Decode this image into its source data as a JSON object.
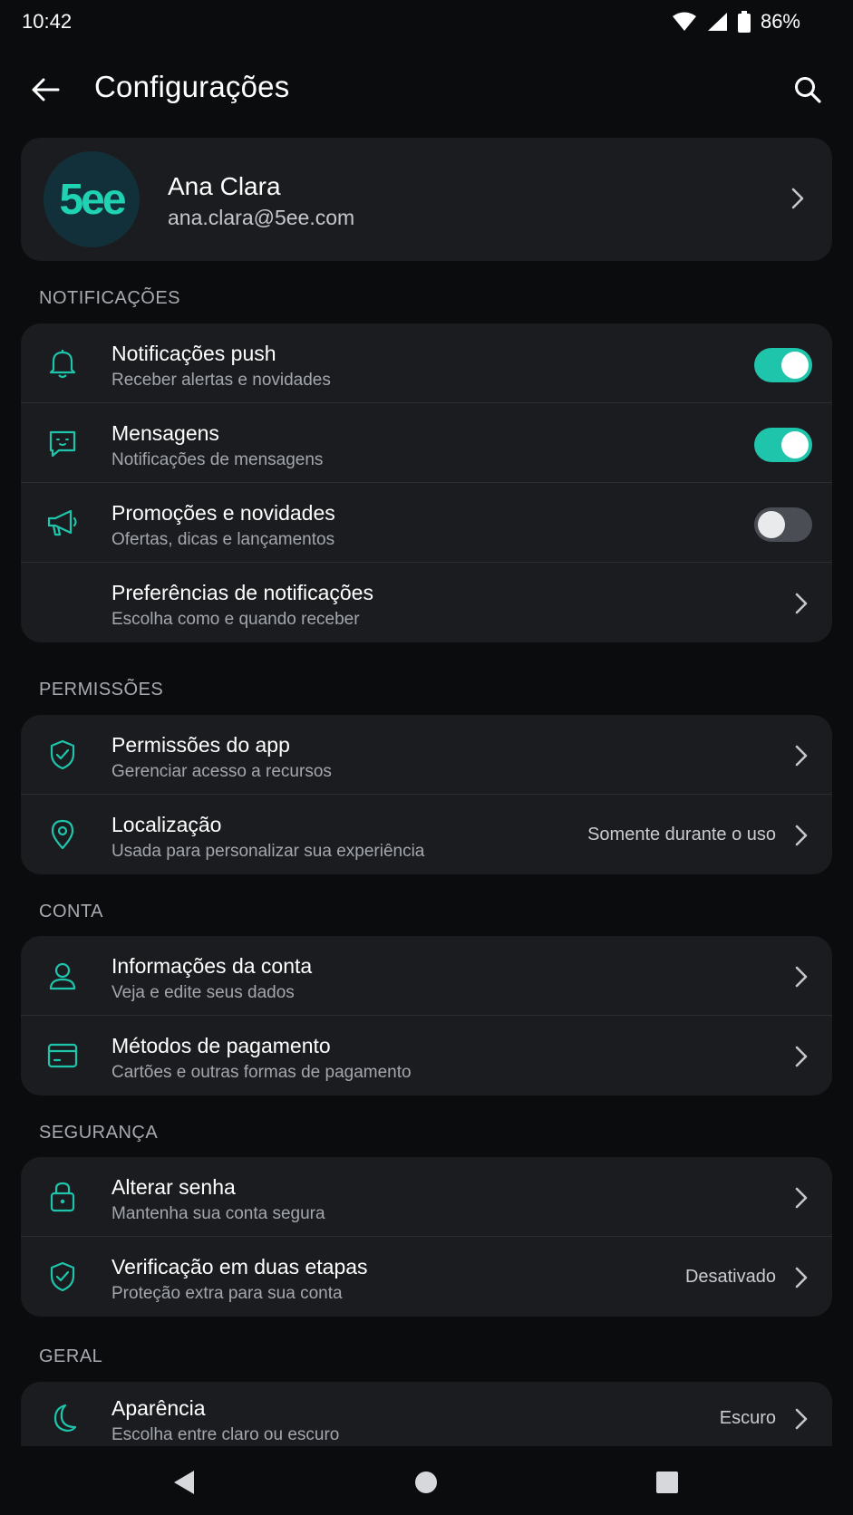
{
  "status_bar": {
    "time": "10:42",
    "battery": "86%"
  },
  "app_bar": {
    "title": "Configurações"
  },
  "profile": {
    "avatar_text": "5ee",
    "name": "Ana Clara",
    "email": "ana.clara@5ee.com"
  },
  "sections": {
    "notificacoes": {
      "label": "NOTIFICAÇÕES",
      "items": [
        {
          "label": "Notificações push",
          "sub": "Receber alertas e novidades",
          "toggle": true
        },
        {
          "label": "Mensagens",
          "sub": "Notificações de mensagens",
          "toggle": true
        },
        {
          "label": "Promoções e novidades",
          "sub": "Ofertas, dicas e lançamentos",
          "toggle": false
        },
        {
          "label": "Preferências de notificações",
          "sub": "Escolha como e quando receber"
        }
      ]
    },
    "permissoes": {
      "label": "PERMISSÕES",
      "items": [
        {
          "label": "Permissões do app",
          "sub": "Gerenciar acesso a recursos"
        },
        {
          "label": "Localização",
          "sub": "Usada para personalizar sua experiência",
          "value": "Somente durante o uso"
        }
      ]
    },
    "conta": {
      "label": "CONTA",
      "items": [
        {
          "label": "Informações da conta",
          "sub": "Veja e edite seus dados"
        },
        {
          "label": "Métodos de pagamento",
          "sub": "Cartões e outras formas de pagamento"
        }
      ]
    },
    "seguranca": {
      "label": "SEGURANÇA",
      "items": [
        {
          "label": "Alterar senha",
          "sub": "Mantenha sua conta segura"
        },
        {
          "label": "Verificação em duas etapas",
          "sub": "Proteção extra para sua conta",
          "value": "Desativado"
        }
      ]
    },
    "geral": {
      "label": "GERAL",
      "items": [
        {
          "label": "Aparência",
          "sub": "Escolha entre claro ou escuro",
          "value": "Escuro"
        }
      ]
    }
  },
  "colors": {
    "accent": "#1fc5ab",
    "background": "#0b0c0e",
    "card": "#1a1c20"
  },
  "icons": [
    "back-arrow-icon",
    "search-icon",
    "bell-icon",
    "message-icon",
    "megaphone-icon",
    "shield-check-icon",
    "location-pin-icon",
    "user-icon",
    "card-icon",
    "lock-icon",
    "moon-icon",
    "chevron-right-icon"
  ]
}
